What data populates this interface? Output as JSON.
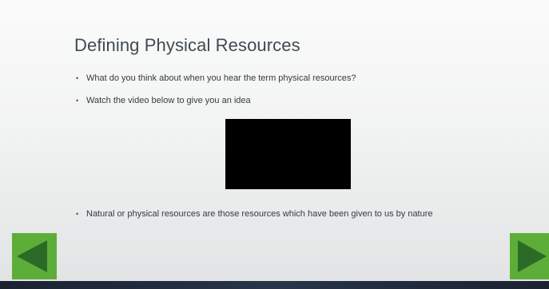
{
  "slide": {
    "title": "Defining Physical Resources",
    "bullets": [
      "What do you think about when you hear the term physical resources?",
      "Watch the video below to give you an idea",
      "Natural or physical resources are those resources which have been given to us by nature"
    ],
    "bullet_symbol": "•"
  },
  "navigation": {
    "prev_icon": "triangle-left-icon",
    "next_icon": "triangle-right-icon"
  },
  "colors": {
    "title": "#3f4a52",
    "nav_button": "#5dae39",
    "nav_arrow": "#2c6b27",
    "video_placeholder": "#000000",
    "footer_bar": "#1d2634"
  }
}
